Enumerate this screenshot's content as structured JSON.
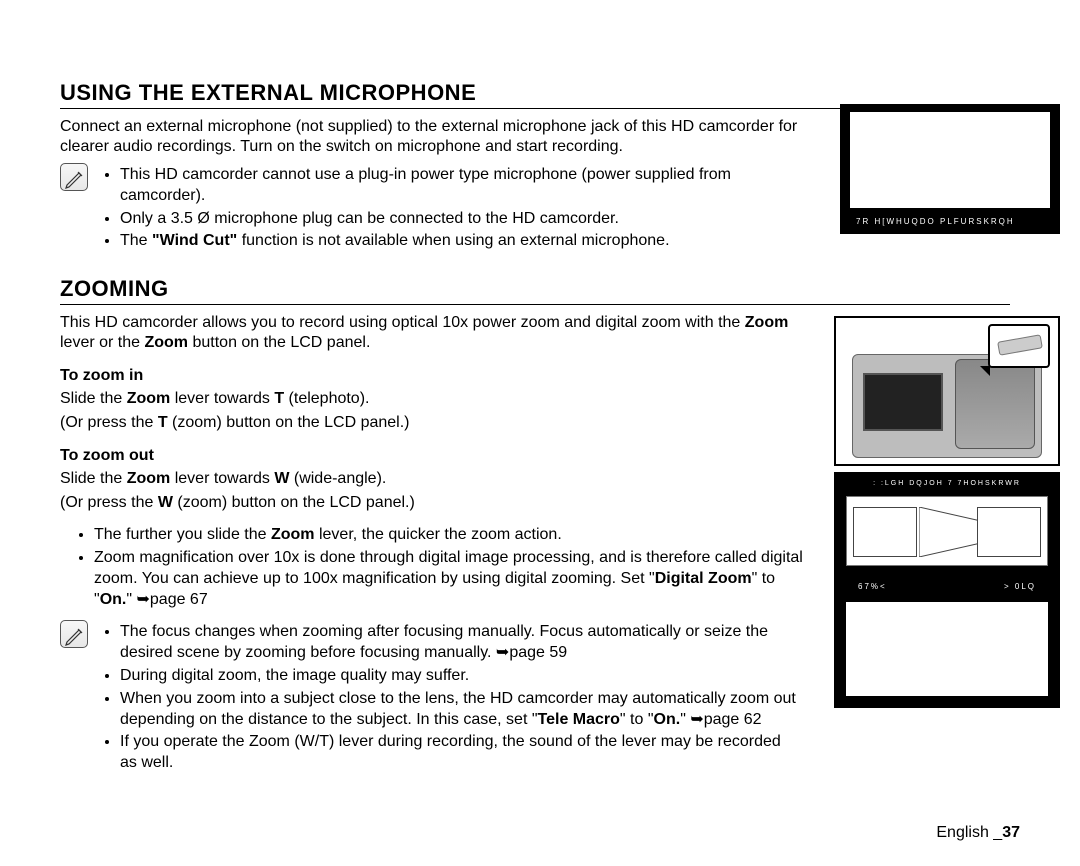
{
  "section1": {
    "heading": "USING THE EXTERNAL MICROPHONE",
    "intro": "Connect an external microphone (not supplied) to the external microphone jack of this HD camcorder for clearer audio recordings. Turn on the switch on microphone and start recording.",
    "note_bullets": [
      "This HD camcorder cannot use a plug-in power type microphone (power supplied from camcorder).",
      "Only a 3.5 Ø microphone plug can be connected to the HD camcorder."
    ],
    "note_bullet3_pre": "The ",
    "note_bullet3_bold": "\"Wind Cut\"",
    "note_bullet3_post": " function is not available when using an external microphone.",
    "fig_caption": "7R  H[WHUQDO  PLFURSKRQH"
  },
  "section2": {
    "heading": "ZOOMING",
    "intro_pre": "This HD camcorder allows you to record using optical 10x power zoom and digital zoom with the ",
    "intro_b1": "Zoom",
    "intro_mid": " lever or the ",
    "intro_b2": "Zoom",
    "intro_post": " button on the LCD panel.",
    "zin_head": "To zoom in",
    "zin_l1_a": "Slide the ",
    "zin_l1_b": "Zoom",
    "zin_l1_c": " lever towards ",
    "zin_l1_d": "T",
    "zin_l1_e": " (telephoto).",
    "zin_l2_a": "(Or press the ",
    "zin_l2_b": "T",
    "zin_l2_c": " (zoom) button on the LCD panel.)",
    "zout_head": "To zoom out",
    "zout_l1_a": "Slide the ",
    "zout_l1_b": "Zoom",
    "zout_l1_c": " lever towards ",
    "zout_l1_d": "W",
    "zout_l1_e": " (wide-angle).",
    "zout_l2_a": "(Or press the ",
    "zout_l2_b": "W",
    "zout_l2_c": " (zoom) button on the LCD panel.)",
    "bullet1_a": "The further you slide the ",
    "bullet1_b": "Zoom",
    "bullet1_c": " lever, the quicker the zoom action.",
    "bullet2_a": "Zoom magnification over 10x is done through digital image processing, and is therefore called digital zoom. You can achieve up to 100x magnification by using digital zooming. Set \"",
    "bullet2_b": "Digital Zoom",
    "bullet2_c": "\" to \"",
    "bullet2_d": "On.",
    "bullet2_e": "\" ",
    "bullet2_arrow": "➥",
    "bullet2_f": "page 67",
    "note_bullets": {
      "b1_a": "The focus changes when zooming after focusing manually. Focus automatically or seize the desired scene by zooming before focusing manually. ",
      "b1_arrow": "➥",
      "b1_b": "page 59",
      "b2": "During digital zoom, the image quality may suffer.",
      "b3_a": "When you zoom into a subject close to the lens, the HD camcorder may automatically zoom out depending on the distance to the subject. In this case, set \"",
      "b3_b": "Tele Macro",
      "b3_c": "\" to \"",
      "b3_d": "On.",
      "b3_e": "\" ",
      "b3_arrow": "➥",
      "b3_f": "page 62",
      "b4": "If you operate the Zoom (W/T) lever during recording, the sound of the lever may be recorded as well."
    },
    "fig2_top": ":  :LGH  DQJOH     7  7HOHSKRWR",
    "fig2_left": "67%<",
    "fig2_right": ">  0LQ"
  },
  "footer": {
    "lang": "English _",
    "page": "37"
  }
}
